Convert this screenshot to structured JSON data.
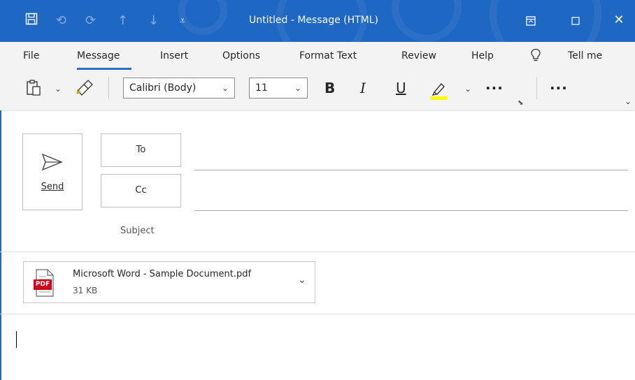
{
  "window": {
    "title": "Untitled  -  Message (HTML)",
    "accent_color": "#1e68c3",
    "quick_access_icons": [
      "save-icon",
      "undo-icon",
      "redo-icon",
      "up-arrow-icon",
      "down-arrow-icon",
      "customize-qat-icon"
    ],
    "controls": [
      "ribbon-display-options-icon",
      "maximize-icon",
      "close-icon"
    ]
  },
  "menu": {
    "tabs": [
      "File",
      "Message",
      "Insert",
      "Options",
      "Format Text",
      "Review",
      "Help"
    ],
    "active_tab": "Message",
    "tell_me": "Tell me"
  },
  "toolbar": {
    "font_name": "Calibri (Body)",
    "font_size": "11",
    "bold": "B",
    "italic": "I",
    "underline": "U",
    "more": "···",
    "more2": "···",
    "highlight_color": "#ffff00"
  },
  "compose": {
    "send_label": "Send",
    "to_label": "To",
    "cc_label": "Cc",
    "subject_label": "Subject",
    "to_value": "",
    "cc_value": "",
    "subject_value": ""
  },
  "attachment": {
    "name": "Microsoft Word - Sample Document.pdf",
    "size": "31 KB",
    "type_label": "PDF"
  },
  "body": {
    "text": ""
  }
}
